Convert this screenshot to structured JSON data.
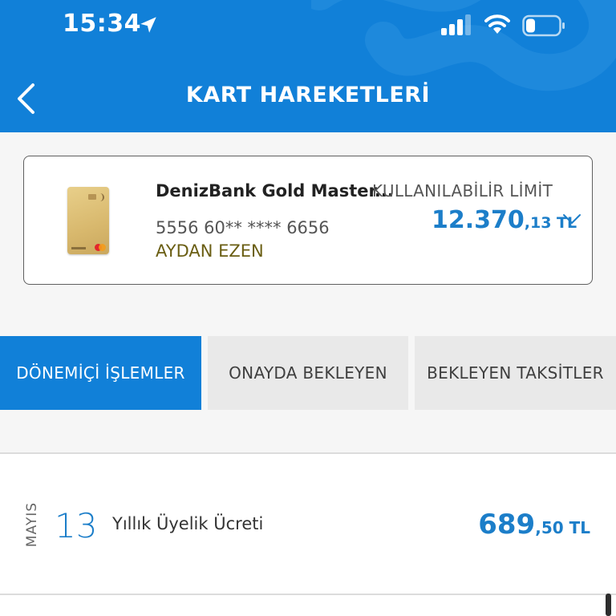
{
  "status_bar": {
    "time": "15:34"
  },
  "header": {
    "title": "KART HAREKETLERİ"
  },
  "card": {
    "name": "DenizBank Gold Master...",
    "number": "5556 60** **** 6656",
    "holder": "AYDAN EZEN",
    "limit_label": "KULLANILABİLİR LİMİT",
    "limit_main": "12.370",
    "limit_decimal": ",13 TL"
  },
  "tabs": [
    {
      "label": "DÖNEMİÇİ İŞLEMLER",
      "active": true
    },
    {
      "label": "ONAYDA BEKLEYEN",
      "active": false
    },
    {
      "label": "BEKLEYEN TAKSİTLER",
      "active": false
    }
  ],
  "transactions": [
    {
      "month": "MAYIS",
      "day": "13",
      "description": "Yıllık Üyelik Ücreti",
      "amount_main": "689",
      "amount_decimal": ",50 TL"
    }
  ],
  "colors": {
    "primary": "#1180d8",
    "amount": "#1c7ec9",
    "holder": "#6a5e13",
    "tab_inactive": "#e9e9e9"
  }
}
